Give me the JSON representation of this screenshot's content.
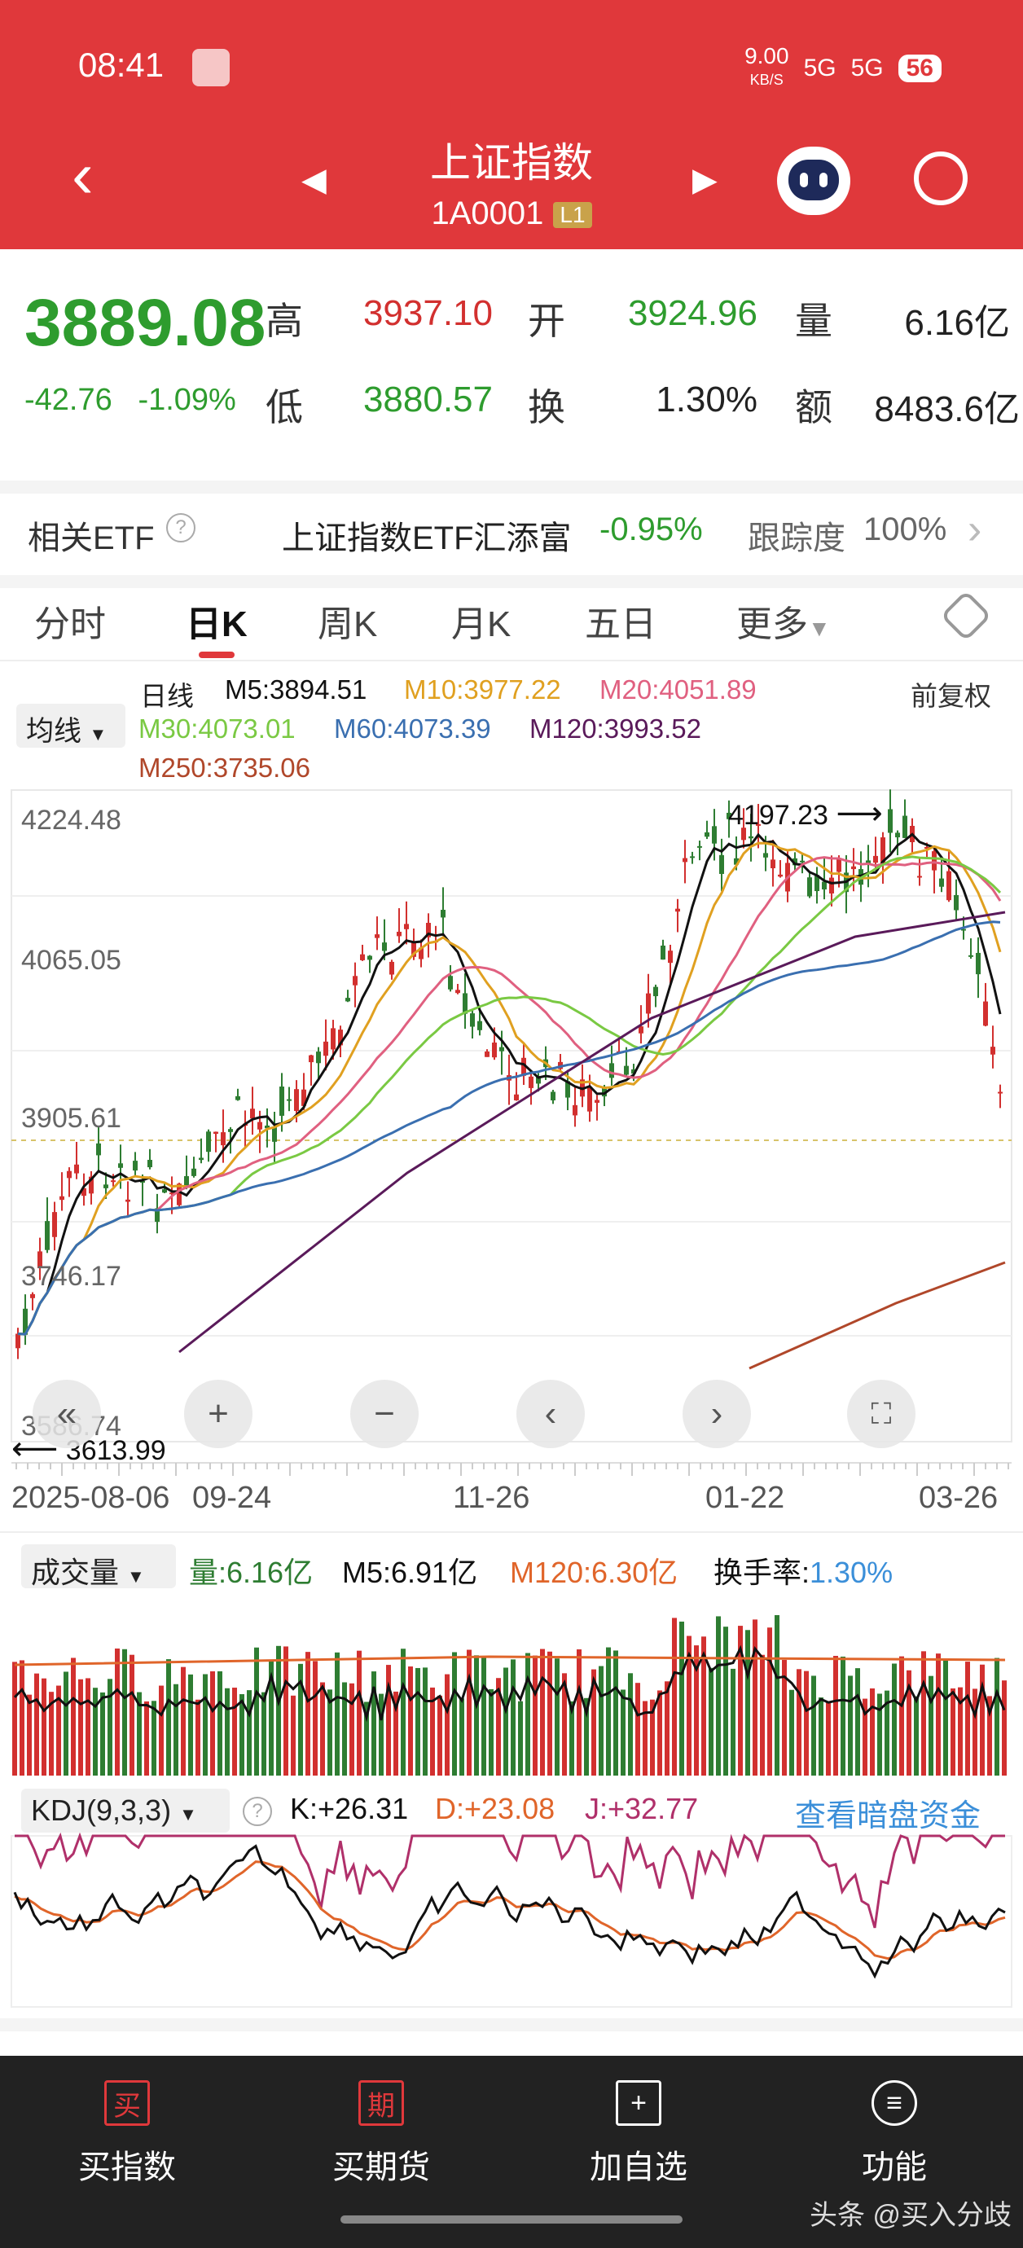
{
  "status": {
    "time": "08:41",
    "speed": "9.00",
    "speed_unit": "KB/S",
    "net1": "5G",
    "net2": "5G",
    "battery": "56"
  },
  "header": {
    "title": "上证指数",
    "code": "1A0001",
    "level": "L1"
  },
  "quote": {
    "price": "3889.08",
    "change": "-42.76",
    "change_pct": "-1.09%",
    "high_label": "高",
    "high": "3937.10",
    "open_label": "开",
    "open": "3924.96",
    "vol_label": "量",
    "vol": "6.16亿",
    "low_label": "低",
    "low": "3880.57",
    "turn_label": "换",
    "turn": "1.30%",
    "amt_label": "额",
    "amt": "8483.6亿"
  },
  "etf": {
    "label": "相关ETF",
    "name": "上证指数ETF汇添富",
    "pct": "-0.95%",
    "track_label": "跟踪度",
    "track": "100%"
  },
  "tabs": [
    "分时",
    "日K",
    "周K",
    "月K",
    "五日",
    "更多"
  ],
  "active_tab": "日K",
  "ma": {
    "selector": "均线",
    "period": "日线",
    "adjust": "前复权",
    "m5": "M5:3894.51",
    "m10": "M10:3977.22",
    "m20": "M20:4051.89",
    "m30": "M30:4073.01",
    "m60": "M60:4073.39",
    "m120": "M120:3993.52",
    "m250": "M250:3735.06"
  },
  "colors": {
    "up": "#d2302f",
    "down": "#2e7d32",
    "m5": "#111111",
    "m10": "#e0a020",
    "m20": "#e06080",
    "m30": "#7ac943",
    "m60": "#3a6fb0",
    "m120": "#5a1a5a",
    "m250": "#b0472a",
    "header": "#e0383b"
  },
  "kchart": {
    "y_ticks": [
      "4224.48",
      "4065.05",
      "3905.61",
      "3746.17",
      "3586.74"
    ],
    "high_mark": "4197.23",
    "low_mark": "3613.99",
    "x_ticks": [
      "2025-08-06",
      "09-24",
      "11-26",
      "01-22",
      "03-26"
    ]
  },
  "volume": {
    "selector": "成交量",
    "vol": "量:6.16亿",
    "m5": "M5:6.91亿",
    "m120": "M120:6.30亿",
    "turn_label": "换手率:",
    "turn": "1.30%"
  },
  "kdj": {
    "selector": "KDJ(9,3,3)",
    "k": "K:+26.31",
    "d": "D:+23.08",
    "j": "J:+32.77",
    "link": "查看暗盘资金"
  },
  "nav": [
    {
      "icon": "买",
      "label": "买指数"
    },
    {
      "icon": "期",
      "label": "买期货"
    },
    {
      "icon": "+",
      "label": "加自选"
    },
    {
      "icon": "≡",
      "label": "功能"
    }
  ],
  "watermark": "头条 @买入分歧"
}
